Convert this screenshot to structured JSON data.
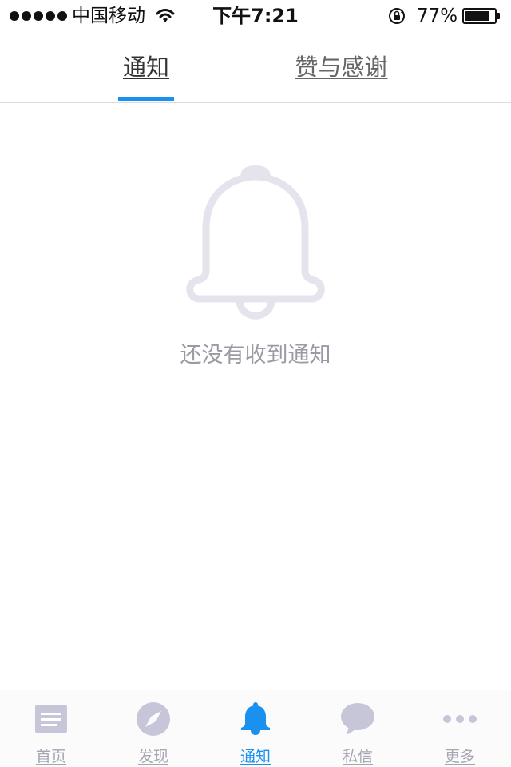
{
  "status_bar": {
    "carrier": "中国移动",
    "time": "下午7:21",
    "battery": "77%"
  },
  "top_tabs": [
    {
      "label": "通知",
      "active": true
    },
    {
      "label": "赞与感谢",
      "active": false
    }
  ],
  "empty_state": {
    "icon": "bell-icon",
    "message": "还没有收到通知"
  },
  "bottom_tabs": [
    {
      "label": "首页",
      "icon": "home-feed-icon",
      "active": false
    },
    {
      "label": "发现",
      "icon": "compass-icon",
      "active": false
    },
    {
      "label": "通知",
      "icon": "bell-icon",
      "active": true
    },
    {
      "label": "私信",
      "icon": "message-bubble-icon",
      "active": false
    },
    {
      "label": "更多",
      "icon": "more-dots-icon",
      "active": false
    }
  ],
  "colors": {
    "accent": "#1a90ef",
    "inactive_icon": "#c6c6d8",
    "empty_icon": "#e4e4ec",
    "muted_text": "#9a9aa5"
  }
}
